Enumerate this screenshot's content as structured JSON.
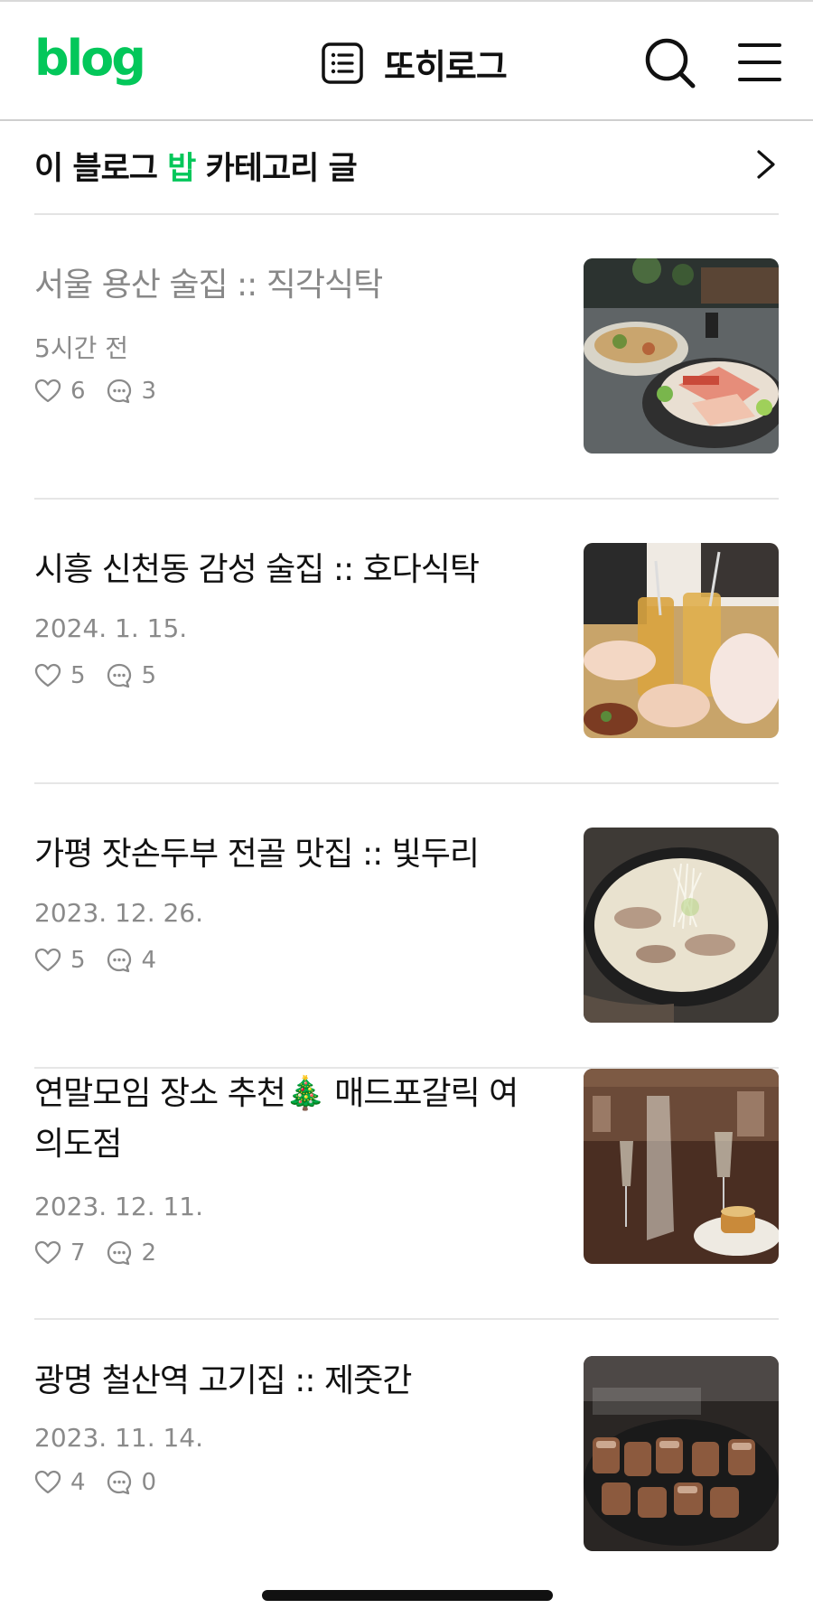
{
  "header": {
    "logo": "blog",
    "blog_title": "또히로그"
  },
  "category": {
    "prefix": "이 블로그 ",
    "name": "밥",
    "suffix": " 카테고리 글"
  },
  "posts": [
    {
      "title": "서울 용산 술집 :: 직각식탁",
      "date": "5시간 전",
      "likes": "6",
      "comments": "3",
      "read": true
    },
    {
      "title": "시흥 신천동 감성 술집 :: 호다식탁",
      "date": "2024. 1. 15.",
      "likes": "5",
      "comments": "5",
      "read": false
    },
    {
      "title": "가평 잣손두부 전골 맛집 :: 빛두리",
      "date": "2023. 12. 26.",
      "likes": "5",
      "comments": "4",
      "read": false
    },
    {
      "title": "연말모임 장소 추천🎄 매드포갈릭 여의도점",
      "date": "2023. 12. 11.",
      "likes": "7",
      "comments": "2",
      "read": false
    },
    {
      "title": "광명 철산역 고기집 :: 제줏간",
      "date": "2023. 11. 14.",
      "likes": "4",
      "comments": "0",
      "read": false
    }
  ],
  "colors": {
    "brand": "#03c75a",
    "muted_text": "#8a8a8a"
  },
  "icons": [
    "list-icon",
    "search-icon",
    "menu-icon",
    "chevron-right-icon",
    "heart-icon",
    "comment-icon"
  ]
}
